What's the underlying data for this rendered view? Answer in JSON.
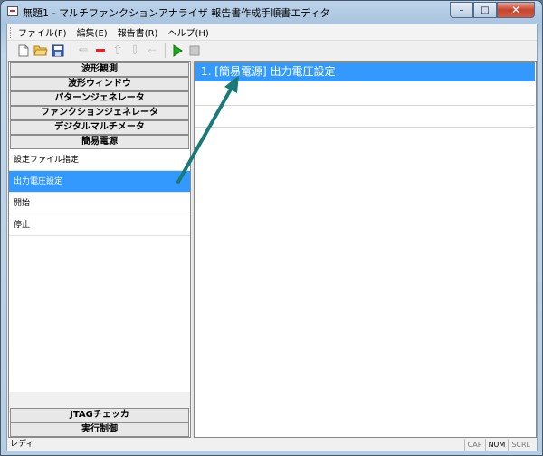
{
  "window": {
    "title": "無題1 - マルチファンクションアナライザ 報告書作成手順書エディタ",
    "icon": "app-document-icon",
    "minimize": "–",
    "maximize": "□",
    "close": "✕"
  },
  "menu": {
    "items": [
      "ファイル(F)",
      "編集(E)",
      "報告書(R)",
      "ヘルプ(H)"
    ]
  },
  "toolbar": {
    "icons": [
      "new-icon",
      "open-folder-icon",
      "save-icon",
      "insert-icon",
      "delete-icon",
      "move-up-icon",
      "move-down-icon",
      "disabled-icon",
      "run-icon",
      "stop-icon"
    ],
    "new": "🗋",
    "open": "📂",
    "save": "💾",
    "insert": "⇐",
    "delete": "▬",
    "up": "⇧",
    "down": "⇩",
    "extra": "⇐",
    "run": "▶",
    "stop": "■"
  },
  "left_pane": {
    "categories_top": [
      "波形観測",
      "波形ウィンドウ",
      "パターンジェネレータ",
      "ファンクションジェネレータ",
      "デジタルマルチメータ",
      "簡易電源"
    ],
    "items": [
      "設定ファイル指定",
      "出力電圧設定",
      "開始",
      "停止"
    ],
    "selected_item": "出力電圧設定",
    "categories_bottom": [
      "JTAGチェッカ",
      "実行制御"
    ]
  },
  "right_pane": {
    "steps": [
      "1. [簡易電源] 出力電圧設定"
    ]
  },
  "status": {
    "text": "レディ",
    "indicators": [
      "CAP",
      "NUM",
      "SCRL"
    ],
    "active_indicator": "NUM"
  },
  "colors": {
    "selection": "#3399ff",
    "annotation_arrow": "#1a7a78",
    "run_green": "#1aaa1a",
    "delete_red": "#d6262a"
  }
}
